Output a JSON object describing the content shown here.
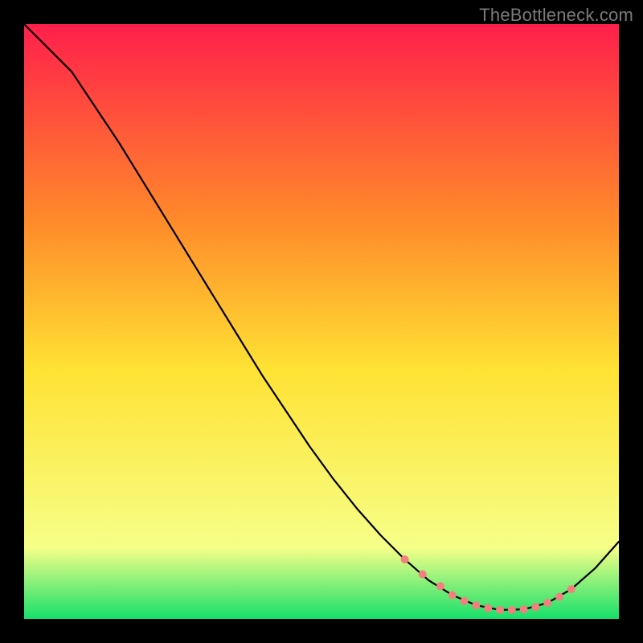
{
  "watermark": "TheBottleneck.com",
  "chart_data": {
    "type": "line",
    "title": "",
    "xlabel": "",
    "ylabel": "",
    "xlim": [
      0,
      100
    ],
    "ylim": [
      0,
      100
    ],
    "grid": false,
    "legend": false,
    "background_gradient": {
      "top_color": "#ff1f4b",
      "mid_upper_color": "#ff8a2a",
      "mid_color": "#ffe234",
      "lower_color": "#f6ff88",
      "bottom_color": "#16e06a"
    },
    "series": [
      {
        "name": "curve",
        "color": "#000000",
        "x": [
          0,
          4,
          8,
          12,
          16,
          20,
          24,
          28,
          32,
          36,
          40,
          44,
          48,
          52,
          56,
          60,
          64,
          68,
          72,
          76,
          80,
          84,
          88,
          92,
          96,
          100
        ],
        "y": [
          100,
          96,
          92,
          86,
          80,
          73.5,
          67,
          60.5,
          54,
          47.5,
          41,
          35,
          29,
          23.5,
          18.5,
          14,
          10,
          6.5,
          4,
          2.3,
          1.5,
          1.6,
          2.7,
          5.0,
          8.5,
          13
        ]
      }
    ],
    "markers": {
      "name": "highlight-dots",
      "color": "#f47f7f",
      "radius": 5,
      "x": [
        64,
        67,
        70,
        72,
        74,
        76,
        78,
        80,
        82,
        84,
        86,
        88,
        90,
        92
      ],
      "y": [
        10,
        7.5,
        5.5,
        4,
        3,
        2.3,
        1.8,
        1.5,
        1.5,
        1.6,
        2.0,
        2.7,
        3.7,
        5.0
      ]
    }
  }
}
